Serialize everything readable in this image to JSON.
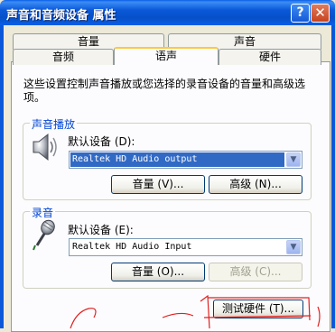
{
  "window": {
    "title": "声音和音频设备 属性",
    "help_glyph": "?",
    "close_glyph": "✕"
  },
  "tabs": {
    "row1": [
      {
        "label": "音量"
      },
      {
        "label": "声音"
      }
    ],
    "row2": [
      {
        "label": "音频"
      },
      {
        "label": "语声",
        "active": true
      },
      {
        "label": "硬件"
      }
    ]
  },
  "description": "这些设置控制声音播放或您选择的录音设备的音量和高级选项。",
  "playback": {
    "group_title": "声音播放",
    "device_label": "默认设备 (D):",
    "device_value": "Realtek HD Audio output",
    "volume_button": "音量 (V)...",
    "advanced_button": "高级 (N)..."
  },
  "recording": {
    "group_title": "录音",
    "device_label": "默认设备 (E):",
    "device_value": "Realtek HD Audio Input",
    "volume_button": "音量 (O)...",
    "advanced_button": "高级 (C)..."
  },
  "test_hardware_button": "测试硬件 (T)...",
  "colors": {
    "titlebar": "#0a58d9",
    "dialog_bg": "#ece9d8",
    "group_title": "#0046d5",
    "annotation": "#e0201e"
  },
  "icons": {
    "playback": "speaker-icon",
    "recording": "microphone-icon"
  }
}
